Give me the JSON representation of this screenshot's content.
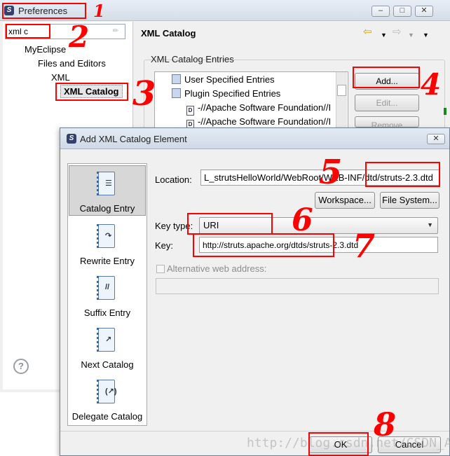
{
  "preferences": {
    "title": "Preferences",
    "filter_value": "xml c",
    "tree": [
      "MyEclipse",
      "Files and Editors",
      "XML",
      "XML Catalog"
    ],
    "page_title": "XML Catalog",
    "group_label": "XML Catalog Entries",
    "entries": [
      "User Specified Entries",
      "Plugin Specified Entries",
      "-//Apache Software Foundation//I",
      "-//Apache Software Foundation//I"
    ],
    "buttons": {
      "add": "Add...",
      "edit": "Edit...",
      "remove": "Remove"
    },
    "help_glyph": "?"
  },
  "dialog": {
    "title": "Add XML Catalog Element",
    "entry_types": [
      "Catalog Entry",
      "Rewrite Entry",
      "Suffix Entry",
      "Next Catalog",
      "Delegate Catalog"
    ],
    "selected_type": "Catalog Entry",
    "location_label": "Location:",
    "location_value": "L_strutsHelloWorld/WebRoot/WEB-INF/dtd/struts-2.3.dtd",
    "workspace_button": "Workspace...",
    "filesystem_button": "File System...",
    "keytype_label": "Key type:",
    "keytype_value": "URI",
    "key_label": "Key:",
    "key_value": "http://struts.apache.org/dtds/struts-2.3.dtd",
    "alt_label": "Alternative web address:",
    "ok": "OK",
    "cancel": "Cancel"
  },
  "annotations": [
    "1",
    "2",
    "3",
    "4",
    "5",
    "6",
    "7",
    "8"
  ],
  "annotation_color": "#ff0000",
  "watermark": "http://blog.csdn.net/CSDN_AL"
}
